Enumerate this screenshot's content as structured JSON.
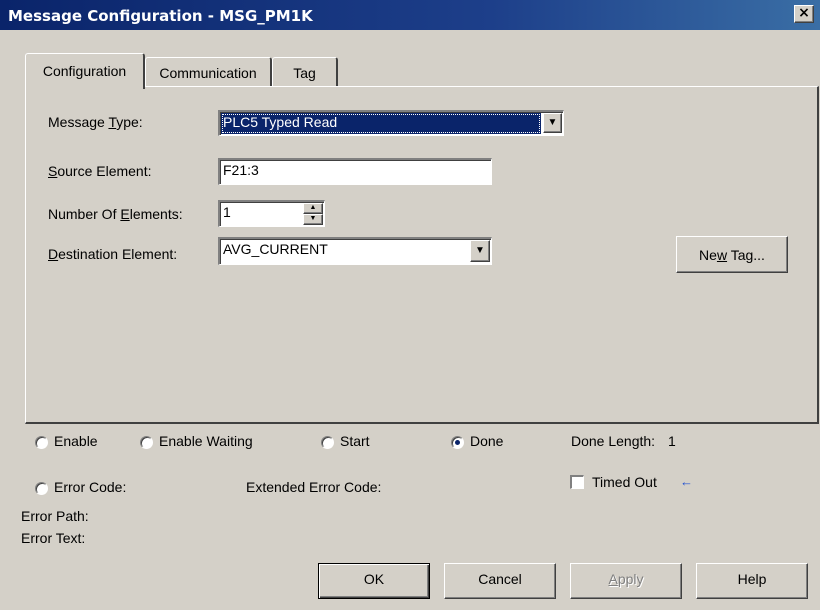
{
  "window": {
    "title": "Message Configuration - MSG_PM1K",
    "close_label": "×"
  },
  "tabs": [
    {
      "label": "Configuration",
      "active": true
    },
    {
      "label": "Communication",
      "active": false
    },
    {
      "label": "Tag",
      "active": false
    }
  ],
  "config": {
    "message_type": {
      "label_pre": "Message ",
      "label_key": "T",
      "label_post": "ype:",
      "value": "PLC5 Typed Read"
    },
    "source_element": {
      "label_pre": "",
      "label_key": "S",
      "label_post": "ource Element:",
      "value": "F21:3"
    },
    "number_of_elements": {
      "label_pre": "Number Of ",
      "label_key": "E",
      "label_post": "lements:",
      "value": "1"
    },
    "destination_element": {
      "label_pre": "",
      "label_key": "D",
      "label_post": "estination Element:",
      "value": "AVG_CURRENT"
    },
    "new_tag_button": {
      "pre": "Ne",
      "key": "w",
      "post": " Tag..."
    }
  },
  "status": {
    "enable": "Enable",
    "enable_waiting": "Enable Waiting",
    "start": "Start",
    "done": "Done",
    "done_length_label": "Done Length:",
    "done_length_value": "1",
    "error_code": "Error Code:",
    "extended_error_code": "Extended Error Code:",
    "timed_out": "Timed Out",
    "error_path": "Error Path:",
    "error_text": "Error Text:",
    "selected_status": "Done"
  },
  "buttons": {
    "ok": "OK",
    "cancel": "Cancel",
    "apply_key": "A",
    "apply_rest": "pply",
    "help": "Help"
  },
  "icons": {
    "dropdown": "chevron-down-icon",
    "spin_up": "arrow-up-icon",
    "spin_down": "arrow-down-icon",
    "timed_out_indicator": "arrow-left-icon"
  },
  "colors": {
    "title_bar": "#0a246a",
    "selection": "#0a246a",
    "indicator_arrow": "#1f4fd0"
  }
}
